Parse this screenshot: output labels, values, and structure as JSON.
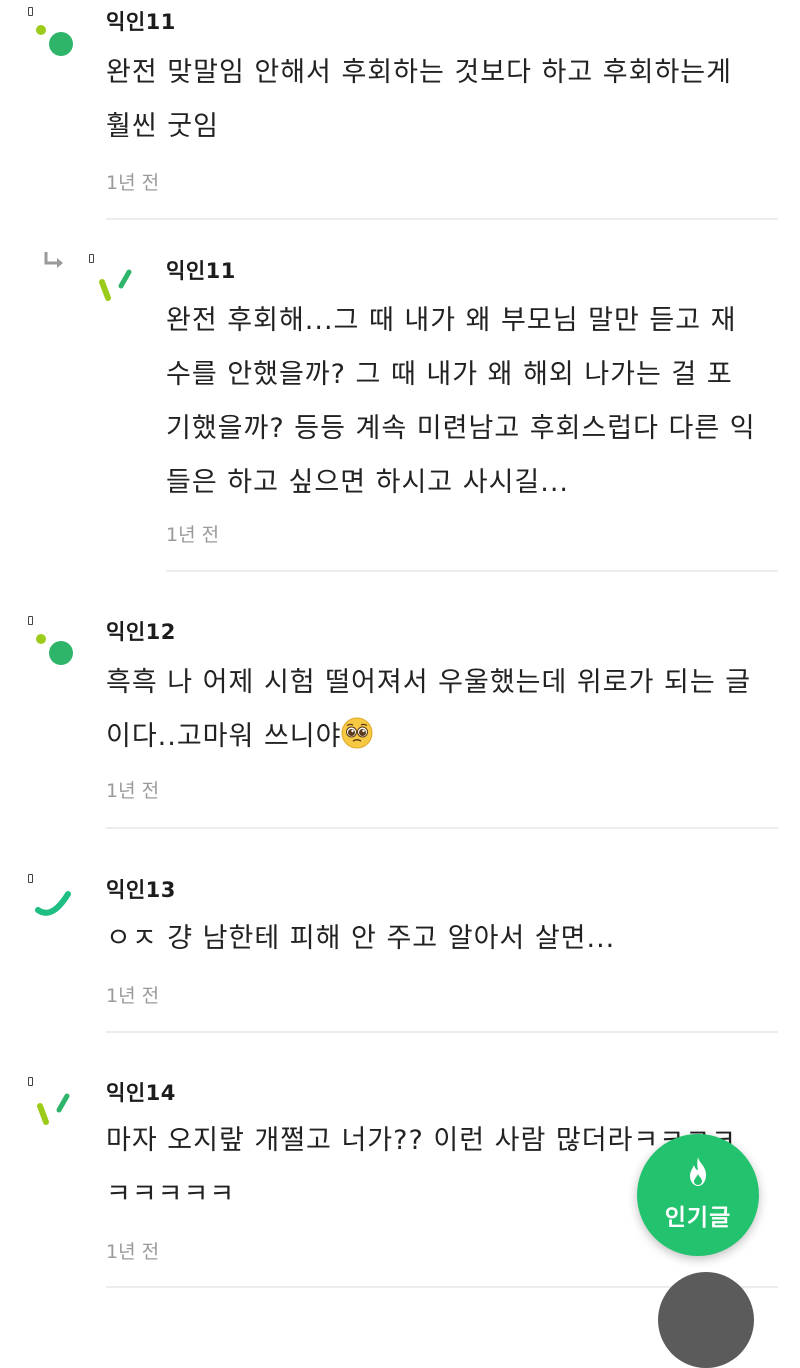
{
  "comments": [
    {
      "author": "익인11",
      "text_lines": [
        "완전 맞말임 안해서 후회하는 것보다 하고 후회하는게",
        "훨씬 굿임"
      ],
      "time": "1년 전"
    },
    {
      "author": "익인11",
      "is_reply": true,
      "text_lines": [
        "완전 후회해...그 때 내가 왜 부모님 말만 듣고 재",
        "수를 안했을까? 그 때 내가 왜 해외 나가는 걸 포",
        "기했을까? 등등 계속 미련남고 후회스럽다 다른 익",
        "들은 하고 싶으면 하시고 사시길..."
      ],
      "time": "1년 전"
    },
    {
      "author": "익인12",
      "text_lines": [
        "흑흑 나 어제 시험 떨어져서 우울했는데 위로가 되는 글",
        "이다..고마워 쓰니야"
      ],
      "emoji": "pleading-face-emoji",
      "time": "1년 전"
    },
    {
      "author": "익인13",
      "text_lines": [
        "ㅇㅈ 걍 남한테 피해 안 주고 알아서 살면..."
      ],
      "time": "1년 전"
    },
    {
      "author": "익인14",
      "text_lines": [
        "마자 오지랖 개쩔고 너가?? 이런 사람 많더라ㅋㅋㅋㅋ",
        "ㅋㅋㅋㅋㅋ"
      ],
      "time": "1년 전"
    }
  ],
  "fab": {
    "label": "인기글",
    "icon": "fire-icon",
    "color": "#23c26e"
  },
  "colors": {
    "avatar_green": "#2fb56a",
    "avatar_lime": "#9ccc1a",
    "avatar_teal": "#1fbf84",
    "time_gray": "#9a9a9a",
    "divider": "#ececec"
  }
}
